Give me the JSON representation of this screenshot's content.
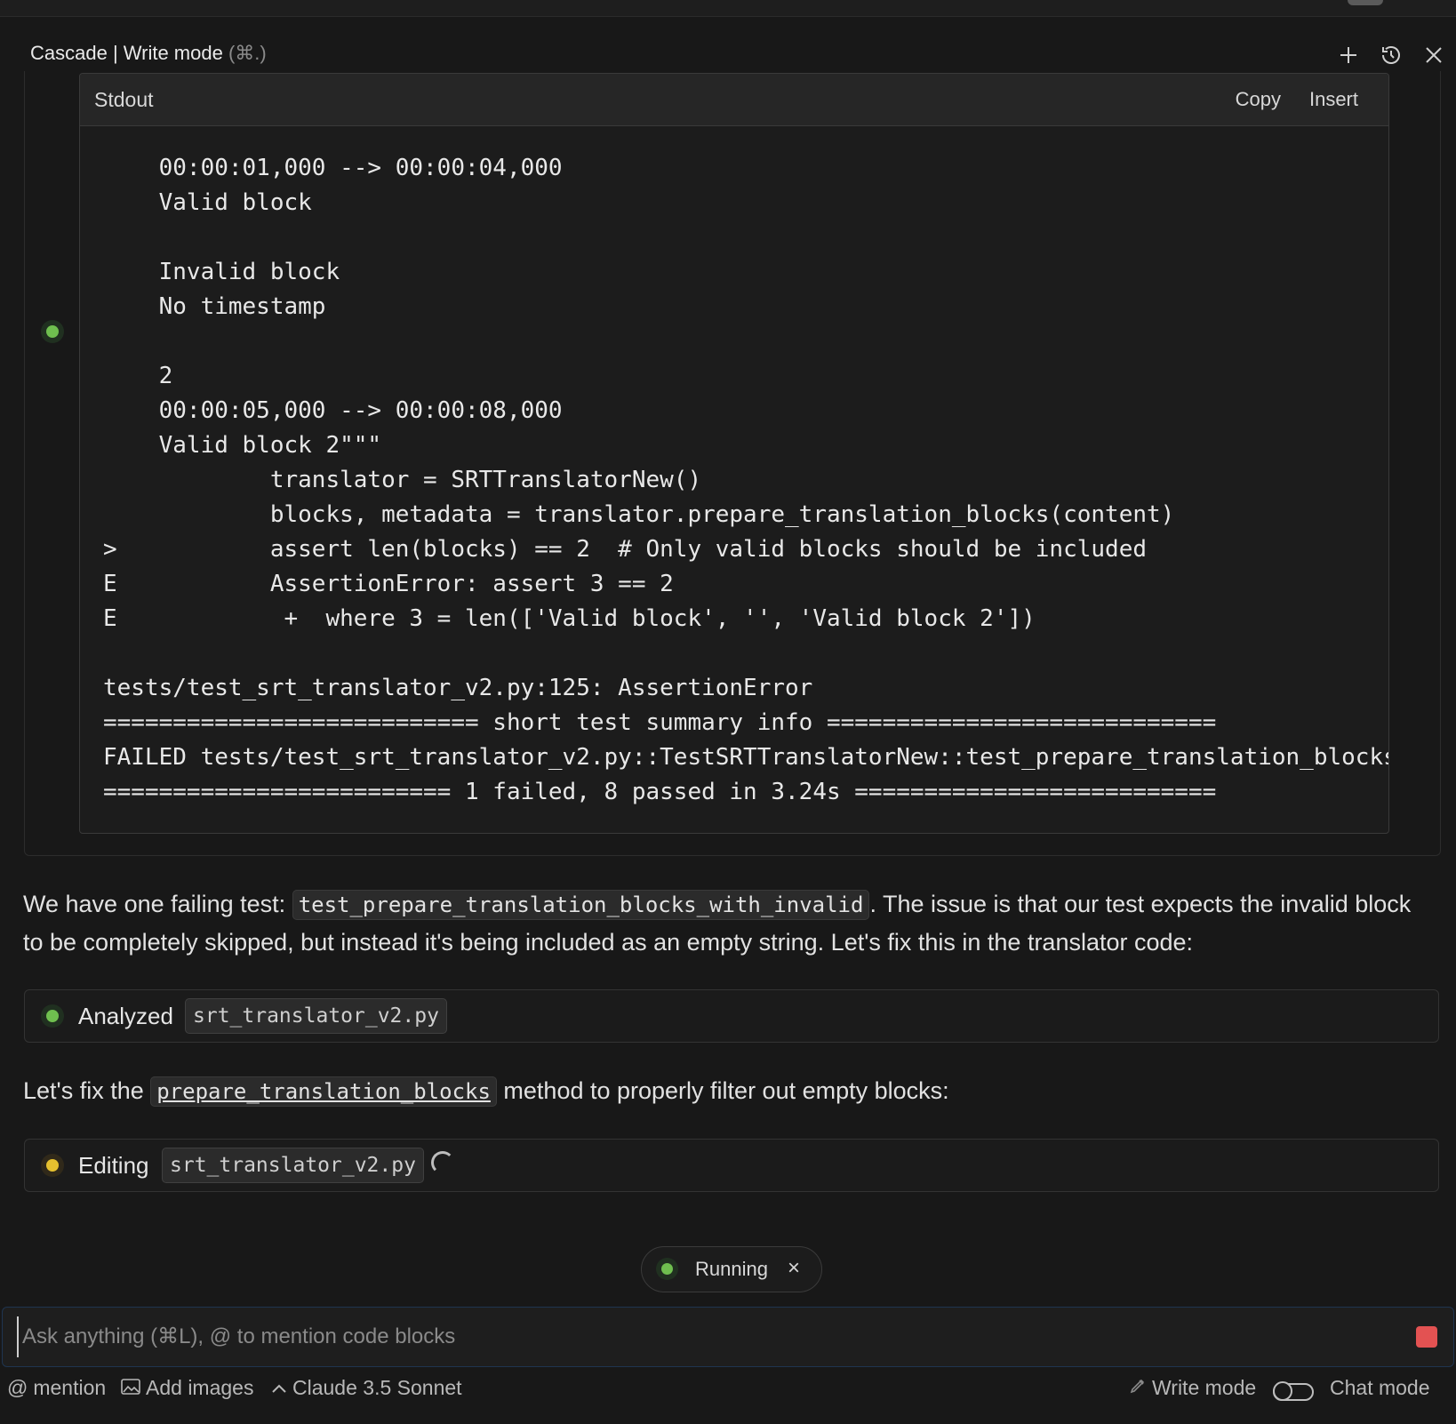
{
  "header": {
    "title": "Cascade | Write mode",
    "shortcut": "(⌘.)",
    "icons": [
      "plus-icon",
      "history-icon",
      "close-icon"
    ]
  },
  "stdout": {
    "title": "Stdout",
    "copy_label": "Copy",
    "insert_label": "Insert",
    "content": "    00:00:01,000 --> 00:00:04,000\n    Valid block\n\n    Invalid block\n    No timestamp\n\n    2\n    00:00:05,000 --> 00:00:08,000\n    Valid block 2\"\"\"\n            translator = SRTTranslatorNew()\n            blocks, metadata = translator.prepare_translation_blocks(content)\n>           assert len(blocks) == 2  # Only valid blocks should be included\nE           AssertionError: assert 3 == 2\nE            +  where 3 = len(['Valid block', '', 'Valid block 2'])\n\ntests/test_srt_translator_v2.py:125: AssertionError\n=========================== short test summary info ============================\nFAILED tests/test_srt_translator_v2.py::TestSRTTranslatorNew::test_prepare_translation_blocks_with_invalid\n========================= 1 failed, 8 passed in 3.24s =========================="
  },
  "message1": {
    "before": "We have one failing test: ",
    "code": "test_prepare_translation_blocks_with_invalid",
    "after": ". The issue is that our test expects the invalid block to be completely skipped, but instead it's being included as an empty string. Let's fix this in the translator code:"
  },
  "step_analyzed": {
    "label": "Analyzed",
    "file": "srt_translator_v2.py",
    "status_color": "#6fbf4f"
  },
  "message2": {
    "before": "Let's fix the ",
    "code": "prepare_translation_blocks",
    "after": " method to properly filter out empty blocks:"
  },
  "step_editing": {
    "label": "Editing",
    "file": "srt_translator_v2.py",
    "status_color": "#e5c02f"
  },
  "running_pill": {
    "label": "Running"
  },
  "input": {
    "placeholder": "Ask anything (⌘L), @ to mention code blocks",
    "value": ""
  },
  "footer": {
    "mention_label": "mention",
    "images_label": "Add images",
    "model_label": "Claude 3.5 Sonnet",
    "write_mode_label": "Write mode",
    "chat_mode_label": "Chat mode"
  }
}
